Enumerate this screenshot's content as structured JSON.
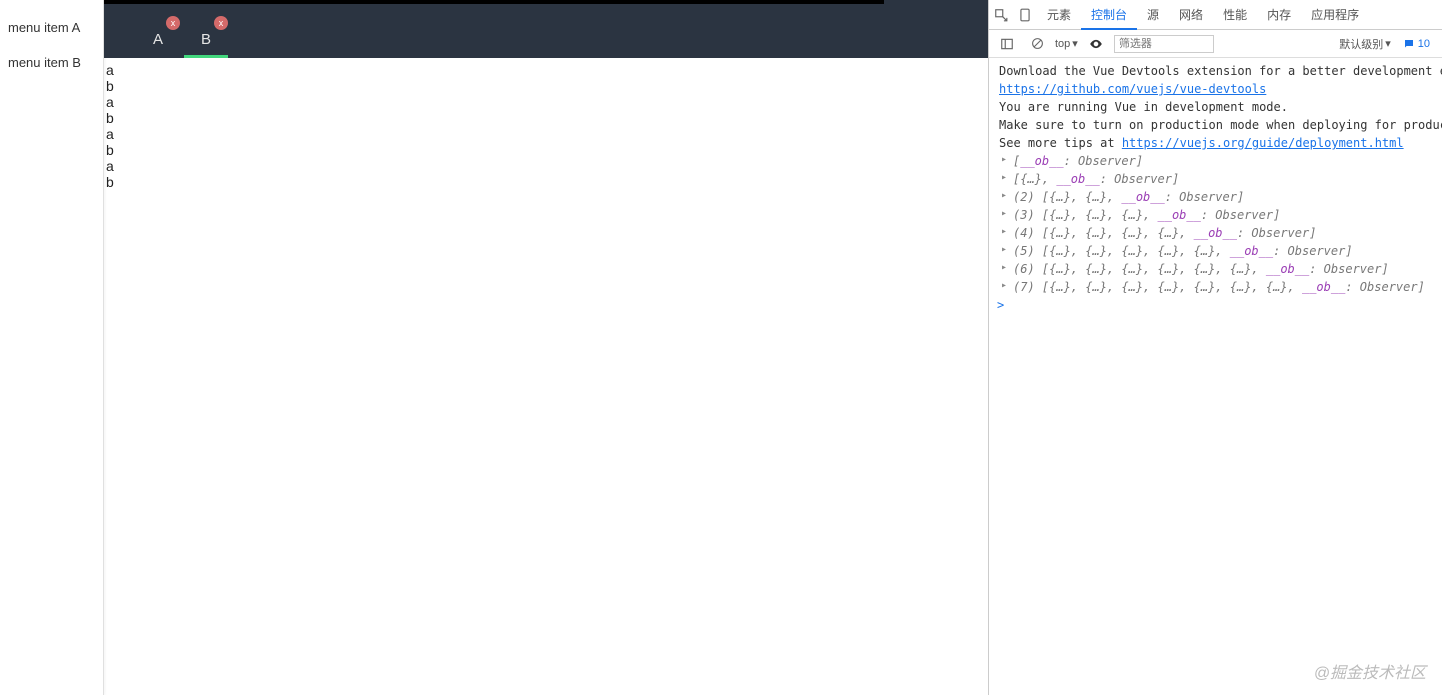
{
  "sidebar": {
    "items": [
      {
        "label": "menu item A"
      },
      {
        "label": "menu item B"
      }
    ]
  },
  "tabs": [
    {
      "label": "A",
      "close": "x",
      "active": false
    },
    {
      "label": "B",
      "close": "x",
      "active": true
    }
  ],
  "content_lines": [
    "a",
    "b",
    "a",
    "b",
    "a",
    "b",
    "a",
    "b"
  ],
  "devtools": {
    "tabs": [
      "元素",
      "控制台",
      "源",
      "网络",
      "性能",
      "内存",
      "应用程序"
    ],
    "active_tab": "控制台",
    "toolbar": {
      "context": "top",
      "filter_placeholder": "筛选器",
      "level": "默认级别",
      "message_count": "10"
    },
    "console": {
      "msg1_a": "Download the Vue Devtools extension for a better development expe",
      "msg1_link": "https://github.com/vuejs/vue-devtools",
      "msg2_a": "You are running Vue in development mode.",
      "msg2_b": "Make sure to turn on production mode when deploying for productio",
      "msg2_c": "See more tips at ",
      "msg2_link": "https://vuejs.org/guide/deployment.html",
      "logs": [
        {
          "prefix": "",
          "body": "[__ob__: Observer]"
        },
        {
          "prefix": "",
          "body": "[{…}, __ob__: Observer]"
        },
        {
          "prefix": "(2) ",
          "body": "[{…}, {…}, __ob__: Observer]"
        },
        {
          "prefix": "(3) ",
          "body": "[{…}, {…}, {…}, __ob__: Observer]"
        },
        {
          "prefix": "(4) ",
          "body": "[{…}, {…}, {…}, {…}, __ob__: Observer]"
        },
        {
          "prefix": "(5) ",
          "body": "[{…}, {…}, {…}, {…}, {…}, __ob__: Observer]"
        },
        {
          "prefix": "(6) ",
          "body": "[{…}, {…}, {…}, {…}, {…}, {…}, __ob__: Observer]"
        },
        {
          "prefix": "(7) ",
          "body": "[{…}, {…}, {…}, {…}, {…}, {…}, {…}, __ob__: Observer]"
        }
      ],
      "prompt": ">"
    }
  },
  "watermark": "@掘金技术社区"
}
